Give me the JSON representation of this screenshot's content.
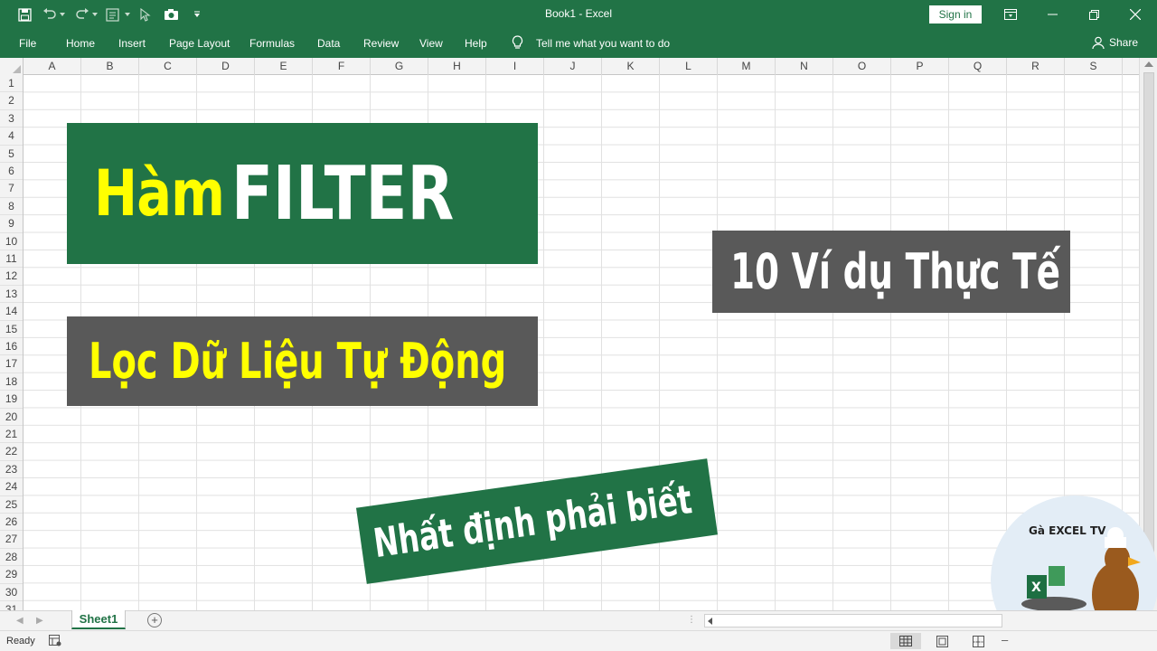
{
  "titlebar": {
    "doc_title": "Book1  -  Excel",
    "sign_in": "Sign in",
    "quick_access": [
      "save-icon",
      "undo-icon",
      "redo-icon",
      "form-icon",
      "pointer-icon",
      "camera-icon",
      "customize-icon"
    ],
    "window_buttons": [
      "ribbon-display-icon",
      "minimize-icon",
      "restore-icon",
      "close-icon"
    ]
  },
  "ribbon": {
    "tabs": [
      "File",
      "Home",
      "Insert",
      "Page Layout",
      "Formulas",
      "Data",
      "Review",
      "View",
      "Help"
    ],
    "tell_me": "Tell me what you want to do",
    "share": "Share"
  },
  "grid": {
    "columns": [
      "A",
      "B",
      "C",
      "D",
      "E",
      "F",
      "G",
      "H",
      "I",
      "J",
      "K",
      "L",
      "M",
      "N",
      "O",
      "P",
      "Q",
      "R",
      "S"
    ],
    "rows": [
      "1",
      "2",
      "3",
      "4",
      "5",
      "6",
      "7",
      "8",
      "9",
      "10",
      "11",
      "12",
      "13",
      "14",
      "15",
      "16",
      "17",
      "18",
      "19",
      "20",
      "21",
      "22",
      "23",
      "24",
      "25",
      "26",
      "27",
      "28",
      "29",
      "30",
      "31"
    ]
  },
  "overlay": {
    "ham": "Hàm",
    "filter": "FILTER",
    "loc": "Lọc Dữ Liệu Tự Động",
    "vidu": "10 Ví dụ Thực Tế",
    "nhat": "Nhất định phải biết",
    "logo_text": "Gà EXCEL TV",
    "colors": {
      "green": "#217346",
      "gray": "#595959",
      "yellow": "#ffff00",
      "white": "#ffffff"
    }
  },
  "sheets": {
    "active": "Sheet1"
  },
  "status": {
    "ready": "Ready"
  }
}
